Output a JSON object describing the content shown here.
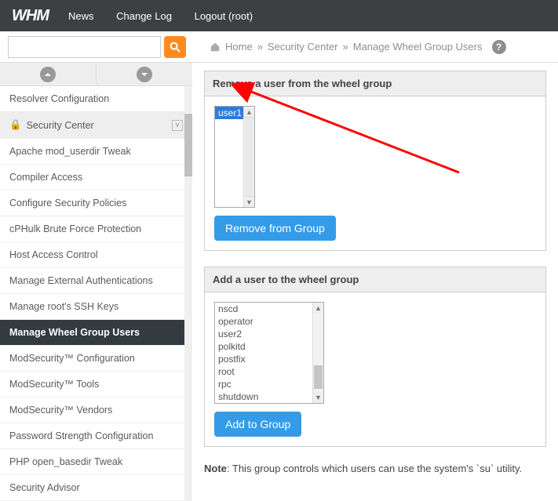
{
  "topnav": {
    "news": "News",
    "changelog": "Change Log",
    "logout": "Logout (root)"
  },
  "logo": "WHM",
  "breadcrumb": {
    "home": "Home",
    "sep": "»",
    "l1": "Security Center",
    "l2": "Manage Wheel Group Users"
  },
  "sidebar": {
    "header": "Security Center",
    "items": [
      "Resolver Configuration",
      "Apache mod_userdir Tweak",
      "Compiler Access",
      "Configure Security Policies",
      "cPHulk Brute Force Protection",
      "Host Access Control",
      "Manage External Authentications",
      "Manage root's SSH Keys",
      "Manage Wheel Group Users",
      "ModSecurity™ Configuration",
      "ModSecurity™ Tools",
      "ModSecurity™ Vendors",
      "Password Strength Configuration",
      "PHP open_basedir Tweak",
      "Security Advisor"
    ],
    "active_index": 8
  },
  "panels": {
    "remove": {
      "title": "Remove a user from the wheel group",
      "options": [
        "user1"
      ],
      "selected": "user1",
      "button": "Remove from Group"
    },
    "add": {
      "title": "Add a user to the wheel group",
      "options": [
        "nscd",
        "operator",
        "user2",
        "polkitd",
        "postfix",
        "root",
        "rpc",
        "shutdown"
      ],
      "button": "Add to Group"
    }
  },
  "note": {
    "label": "Note",
    "text": ": This group controls which users can use the system's `su` utility."
  }
}
